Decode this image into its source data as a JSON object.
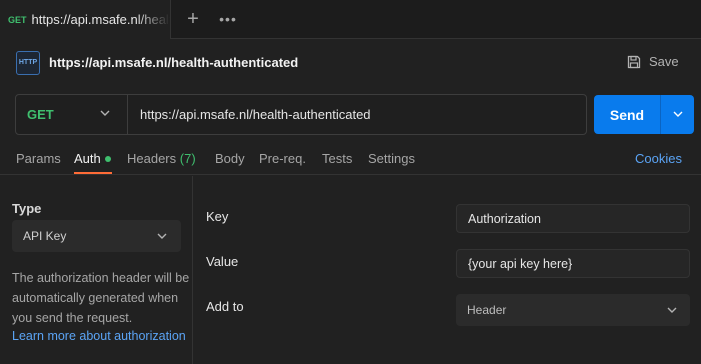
{
  "tabs": [
    {
      "method": "GET",
      "url": "https://api.msafe.nl/health-authenticated"
    }
  ],
  "tabbar": {
    "new_tab_icon": "plus-icon",
    "more_icon": "more-horizontal-icon"
  },
  "request": {
    "title": "https://api.msafe.nl/health-authenticated",
    "icon_text": "HTTP",
    "save_label": "Save",
    "method": "GET",
    "url": "https://api.msafe.nl/health-authenticated",
    "send_label": "Send"
  },
  "subtabs": {
    "params": "Params",
    "auth": "Auth",
    "headers": "Headers",
    "headers_count": "(7)",
    "body": "Body",
    "prereq": "Pre-req.",
    "tests": "Tests",
    "settings": "Settings",
    "cookies": "Cookies"
  },
  "auth": {
    "type_label": "Type",
    "type_value": "API Key",
    "description": "The authorization header will be automatically generated when you send the request.",
    "learn_more": "Learn more about authorization",
    "rows": {
      "key_label": "Key",
      "key_value": "Authorization",
      "value_label": "Value",
      "value_value": "{your api key here}",
      "addto_label": "Add to",
      "addto_value": "Header"
    }
  },
  "colors": {
    "accent_orange": "#ff6c37",
    "send_blue": "#097bed",
    "method_green": "#3fbf6e",
    "link_blue": "#5ba4f5"
  }
}
